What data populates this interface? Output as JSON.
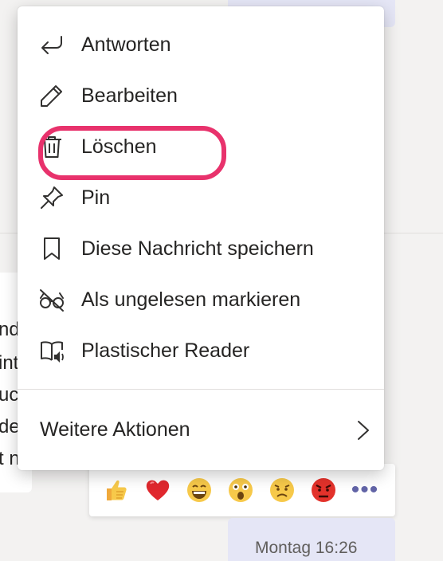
{
  "background": {
    "message_fragments": [
      "nd",
      "int",
      "uc",
      "de",
      "t n"
    ]
  },
  "context_menu": {
    "items": [
      {
        "label": "Antworten",
        "icon": "reply-icon"
      },
      {
        "label": "Bearbeiten",
        "icon": "pencil-icon"
      },
      {
        "label": "Löschen",
        "icon": "trash-icon"
      },
      {
        "label": "Pin",
        "icon": "pin-icon"
      },
      {
        "label": "Diese Nachricht speichern",
        "icon": "bookmark-icon"
      },
      {
        "label": "Als ungelesen markieren",
        "icon": "glasses-off-icon"
      },
      {
        "label": "Plastischer Reader",
        "icon": "immersive-reader-icon"
      }
    ],
    "more_actions_label": "Weitere Aktionen",
    "highlighted_item": "Löschen",
    "highlight_color": "#e8326c"
  },
  "reactions": {
    "items": [
      "like",
      "heart",
      "laugh",
      "surprised",
      "sad",
      "angry"
    ],
    "more_label": "•••"
  },
  "sent_message": {
    "timestamp": "Montag 16:26"
  },
  "colors": {
    "accent": "#6264a7",
    "bubble": "#e5e6f6",
    "text": "#252423"
  }
}
